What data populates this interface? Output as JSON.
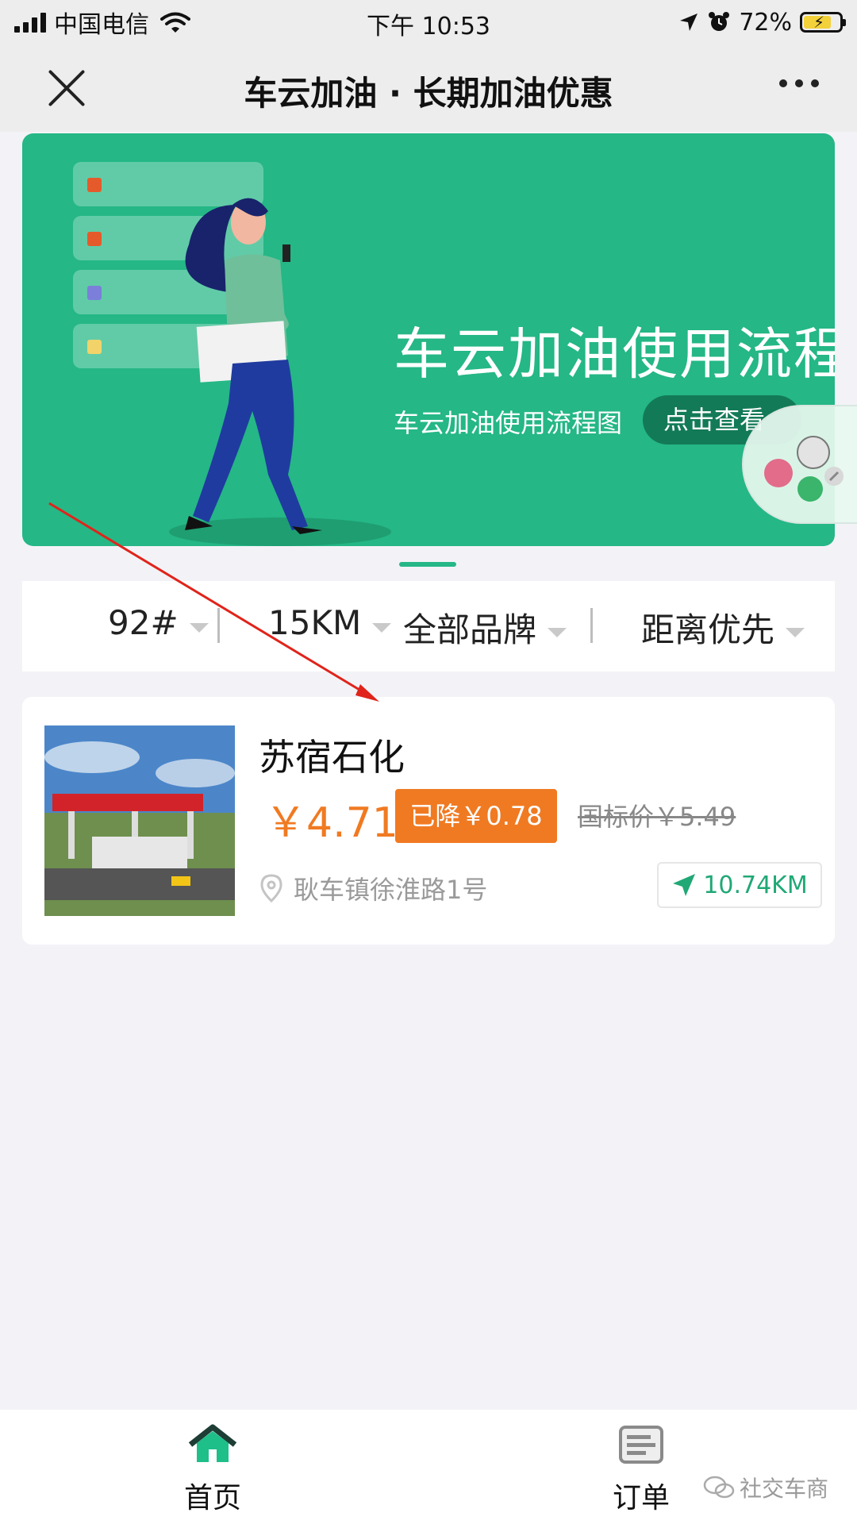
{
  "status_bar": {
    "carrier": "中国电信",
    "time": "下午 10:53",
    "battery": "72%"
  },
  "title_bar": {
    "title": "车云加油 · 长期加油优惠"
  },
  "banner": {
    "title": "车云加油使用流程",
    "subtitle": "车云加油使用流程图",
    "button_label": "点击查看"
  },
  "filters": [
    {
      "label": "92#"
    },
    {
      "label": "15KM"
    },
    {
      "label": "全部品牌"
    },
    {
      "label": "距离优先"
    }
  ],
  "station": {
    "name": "苏宿石化",
    "price": "￥4.71",
    "discount": "已降￥0.78",
    "national_price": "国标价￥5.49",
    "address": "耿车镇徐淮路1号",
    "distance": "10.74KM"
  },
  "tabs": [
    {
      "label": "首页",
      "icon": "home-icon",
      "color": "#20a876"
    },
    {
      "label": "订单",
      "icon": "order-icon",
      "color": "#8a8a8a"
    }
  ],
  "watermark": "社交车商",
  "colors": {
    "brand_green": "#25b786",
    "price_orange": "#f07a22",
    "arrow_red": "#e0241b"
  }
}
